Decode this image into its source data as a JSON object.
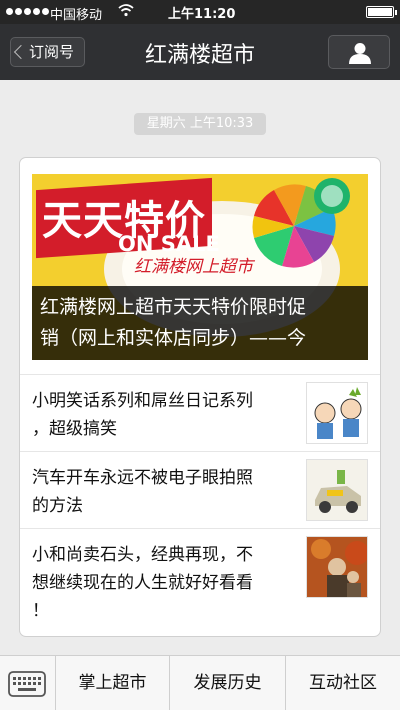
{
  "status_bar": {
    "carrier": "中国移动",
    "time": "上午11:20"
  },
  "nav": {
    "back_label": "订阅号",
    "title": "红满楼超市"
  },
  "timestamp": "星期六 上午10:33",
  "card": {
    "hero": {
      "banner_title": "天天特价",
      "banner_onsale": "ON SALE",
      "banner_sub": "红满楼网上超市",
      "caption_line1": "红满楼网上超市天天特价限时促",
      "caption_line2": "销（网上和实体店同步）——今"
    },
    "items": [
      {
        "line1": "小明笑话系列和屌丝日记系列",
        "line2": "，超级搞笑",
        "thumb_icon": "cartoon-boys-icon"
      },
      {
        "line1": "汽车开车永远不被电子眼拍照",
        "line2": "的方法",
        "thumb_icon": "toy-car-icon"
      },
      {
        "line1": "小和尚卖石头，经典再现，不",
        "line2": "想继续现在的人生就好好看看",
        "line3": "！",
        "thumb_icon": "autumn-photo-icon"
      }
    ]
  },
  "bottom_menu": {
    "items": [
      "掌上超市",
      "发展历史",
      "互动社区"
    ]
  }
}
